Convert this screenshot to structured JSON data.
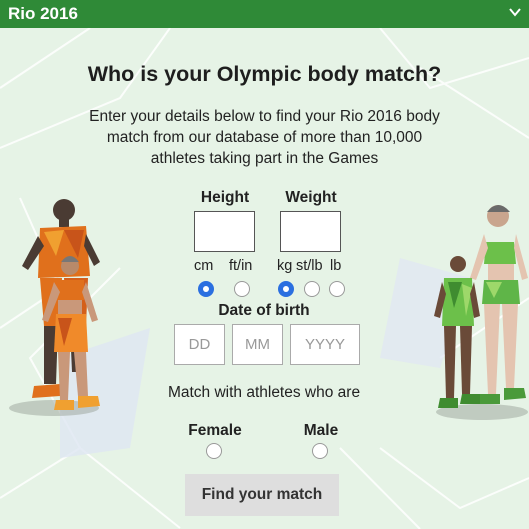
{
  "header": {
    "title": "Rio 2016",
    "toggle_icon": "chevron-down-icon"
  },
  "heading": "Who is your Olympic body match?",
  "intro": "Enter your details below to find your Rio 2016 body match from our database of more than 10,000 athletes taking part in the Games",
  "height": {
    "label": "Height",
    "units": [
      "cm",
      "ft/in"
    ],
    "selected": "cm",
    "value": ""
  },
  "weight": {
    "label": "Weight",
    "units": [
      "kg",
      "st/lb",
      "lb"
    ],
    "selected": "kg",
    "value": ""
  },
  "dob": {
    "label": "Date of birth",
    "day_placeholder": "DD",
    "month_placeholder": "MM",
    "year_placeholder": "YYYY"
  },
  "match": {
    "prompt": "Match with athletes who are",
    "options": [
      "Female",
      "Male"
    ],
    "selected": null
  },
  "submit": "Find your match",
  "colors": {
    "header": "#2f8a37",
    "background": "#e6f3e6",
    "radio_selected": "#2b6fe0",
    "button": "#dedede",
    "left_figures": "#e0701c",
    "right_figures": "#5fb548"
  },
  "illustrations": [
    "athletes-orange-illustration",
    "athletes-green-illustration"
  ]
}
